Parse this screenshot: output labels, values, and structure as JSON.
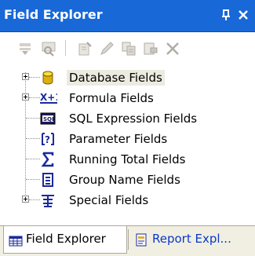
{
  "window": {
    "title": "Field Explorer",
    "pin_glyph": "p",
    "close_glyph": "×"
  },
  "toolbar": {
    "icons": [
      "insert-to-report-icon",
      "browse-icon",
      "new-icon",
      "edit-icon",
      "duplicate-icon",
      "rename-icon",
      "delete-icon"
    ]
  },
  "tree": {
    "items": [
      {
        "label": "Database Fields",
        "icon": "database-cylinder-icon",
        "expandable": true,
        "selected": true
      },
      {
        "label": "Formula Fields",
        "icon": "formula-x-plus-1-icon",
        "expandable": true,
        "selected": false
      },
      {
        "label": "SQL Expression Fields",
        "icon": "sql-icon",
        "expandable": false,
        "selected": false
      },
      {
        "label": "Parameter Fields",
        "icon": "parameter-question-icon",
        "expandable": false,
        "selected": false
      },
      {
        "label": "Running Total Fields",
        "icon": "sigma-icon",
        "expandable": false,
        "selected": false
      },
      {
        "label": "Group Name Fields",
        "icon": "group-name-icon",
        "expandable": false,
        "selected": false
      },
      {
        "label": "Special Fields",
        "icon": "special-fields-icon",
        "expandable": true,
        "selected": false
      }
    ]
  },
  "tabs": [
    {
      "label": "Field Explorer",
      "active": true
    },
    {
      "label": "Report Expl...",
      "active": false
    }
  ],
  "colors": {
    "title_bar": "#1868d8",
    "selection": "#ecebe0",
    "tab_link": "#0a38c8"
  }
}
